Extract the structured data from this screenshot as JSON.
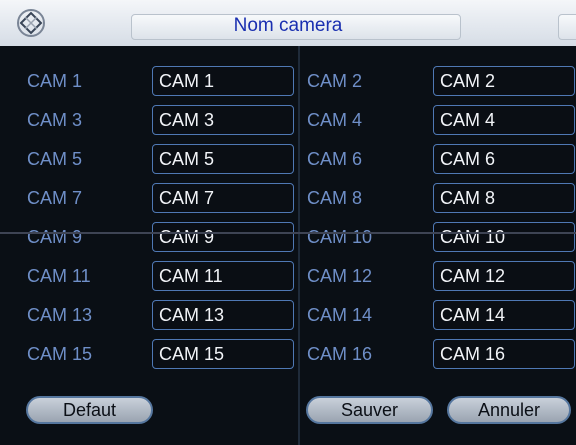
{
  "window": {
    "title": "Nom camera"
  },
  "cameras": [
    {
      "label": "CAM 1",
      "name": "CAM 1"
    },
    {
      "label": "CAM 2",
      "name": "CAM 2"
    },
    {
      "label": "CAM 3",
      "name": "CAM 3"
    },
    {
      "label": "CAM 4",
      "name": "CAM 4"
    },
    {
      "label": "CAM 5",
      "name": "CAM 5"
    },
    {
      "label": "CAM 6",
      "name": "CAM 6"
    },
    {
      "label": "CAM 7",
      "name": "CAM 7"
    },
    {
      "label": "CAM 8",
      "name": "CAM 8"
    },
    {
      "label": "CAM 9",
      "name": "CAM 9"
    },
    {
      "label": "CAM 10",
      "name": "CAM 10"
    },
    {
      "label": "CAM 11",
      "name": "CAM 11"
    },
    {
      "label": "CAM 12",
      "name": "CAM 12"
    },
    {
      "label": "CAM 13",
      "name": "CAM 13"
    },
    {
      "label": "CAM 14",
      "name": "CAM 14"
    },
    {
      "label": "CAM 15",
      "name": "CAM 15"
    },
    {
      "label": "CAM 16",
      "name": "CAM 16"
    }
  ],
  "buttons": {
    "default": "Defaut",
    "save": "Sauver",
    "cancel": "Annuler"
  },
  "icons": {
    "logo": "app-logo-icon"
  },
  "colors": {
    "title_text": "#1a2fb0",
    "label_text": "#6f8fc8",
    "field_border": "#4f78b4"
  }
}
